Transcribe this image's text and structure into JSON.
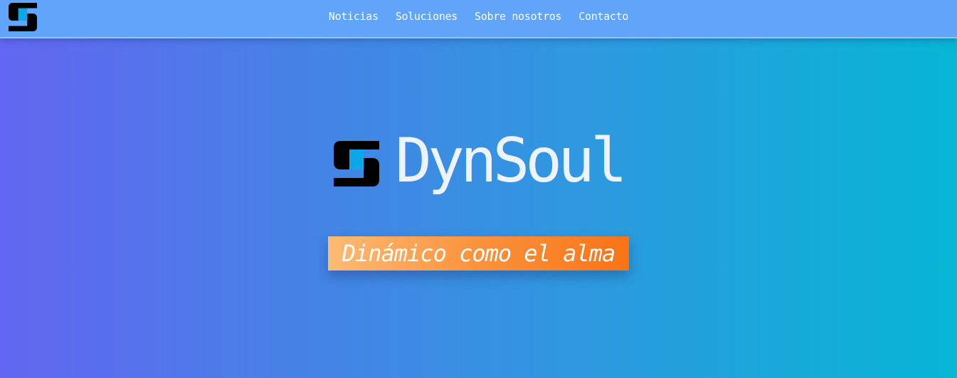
{
  "nav": {
    "links": [
      {
        "label": "Noticias"
      },
      {
        "label": "Soluciones"
      },
      {
        "label": "Sobre nosotros"
      },
      {
        "label": "Contacto"
      }
    ]
  },
  "hero": {
    "brand_name": "DynSoul",
    "tagline": "Dinámico como el alma"
  },
  "colors": {
    "navbar": "#60a5fa",
    "gradient_start": "#6366f1",
    "gradient_end": "#06b6d4",
    "tagline_start": "#fdba74",
    "tagline_end": "#f97316",
    "logo_dark": "#000000",
    "logo_accent": "#0ea5e9"
  },
  "icons": {
    "logo": "dynsoul-logo-icon"
  }
}
